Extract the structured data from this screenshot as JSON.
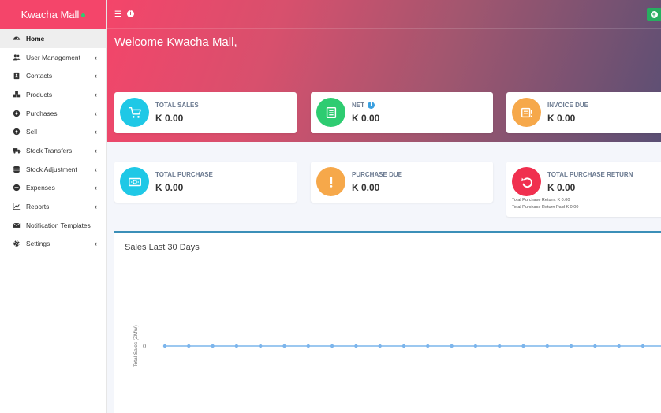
{
  "brand": {
    "name": "Kwacha Mall"
  },
  "sidebar": {
    "items": [
      {
        "label": "Home",
        "icon": "dashboard-icon",
        "active": true,
        "chevron": false
      },
      {
        "label": "User Management",
        "icon": "users-icon",
        "active": false,
        "chevron": true
      },
      {
        "label": "Contacts",
        "icon": "address-book-icon",
        "active": false,
        "chevron": true
      },
      {
        "label": "Products",
        "icon": "cubes-icon",
        "active": false,
        "chevron": true
      },
      {
        "label": "Purchases",
        "icon": "arrow-circle-down-icon",
        "active": false,
        "chevron": true
      },
      {
        "label": "Sell",
        "icon": "arrow-circle-up-icon",
        "active": false,
        "chevron": true
      },
      {
        "label": "Stock Transfers",
        "icon": "truck-icon",
        "active": false,
        "chevron": true
      },
      {
        "label": "Stock Adjustment",
        "icon": "database-icon",
        "active": false,
        "chevron": true
      },
      {
        "label": "Expenses",
        "icon": "minus-circle-icon",
        "active": false,
        "chevron": true
      },
      {
        "label": "Reports",
        "icon": "line-chart-icon",
        "active": false,
        "chevron": true
      },
      {
        "label": "Notification Templates",
        "icon": "envelope-icon",
        "active": false,
        "chevron": false
      },
      {
        "label": "Settings",
        "icon": "cog-icon",
        "active": false,
        "chevron": true
      }
    ]
  },
  "header": {
    "welcome": "Welcome Kwacha Mall,"
  },
  "cards": {
    "total_sales": {
      "title": "TOTAL SALES",
      "value": "K 0.00",
      "color": "#1fc8e6"
    },
    "net": {
      "title": "NET",
      "value": "K 0.00",
      "color": "#2ecc71"
    },
    "invoice_due": {
      "title": "INVOICE DUE",
      "value": "K 0.00",
      "color": "#f6a84a"
    },
    "total_purchase": {
      "title": "TOTAL PURCHASE",
      "value": "K 0.00",
      "color": "#1fc8e6"
    },
    "purchase_due": {
      "title": "PURCHASE DUE",
      "value": "K 0.00",
      "color": "#f6a84a"
    },
    "total_purchase_return": {
      "title": "TOTAL PURCHASE RETURN",
      "value": "K 0.00",
      "color": "#f0304f",
      "note1": "Total Purchase Return: K 0.00",
      "note2": "Total Purchase Return Paid K 0.00"
    }
  },
  "chart_data": {
    "type": "line",
    "title": "Sales Last 30 Days",
    "ylabel": "Total Sales (ZMW)",
    "xlabel": "",
    "yticks": [
      "0"
    ],
    "values": [
      0,
      0,
      0,
      0,
      0,
      0,
      0,
      0,
      0,
      0,
      0,
      0,
      0,
      0,
      0,
      0,
      0,
      0,
      0,
      0,
      0,
      0
    ],
    "line_color": "#7cb5ec"
  }
}
